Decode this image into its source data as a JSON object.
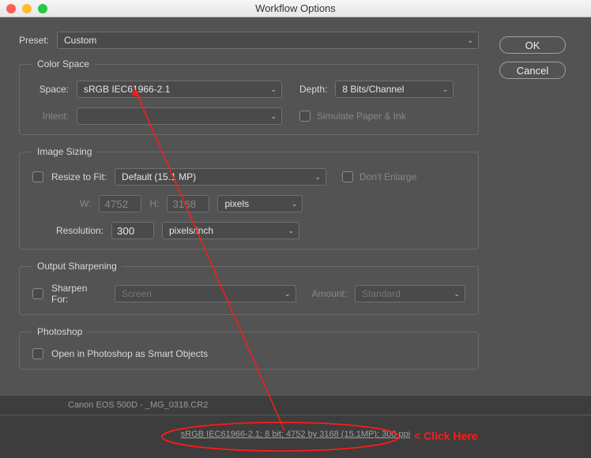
{
  "window_title": "Workflow Options",
  "preset_label": "Preset:",
  "preset_value": "Custom",
  "buttons": {
    "ok": "OK",
    "cancel": "Cancel"
  },
  "colorspace": {
    "legend": "Color Space",
    "space_label": "Space:",
    "space_value": "sRGB IEC61966-2.1",
    "depth_label": "Depth:",
    "depth_value": "8 Bits/Channel",
    "intent_label": "Intent:",
    "intent_value": "",
    "simulate_label": "Simulate Paper & Ink"
  },
  "sizing": {
    "legend": "Image Sizing",
    "resize_label": "Resize to Fit:",
    "resize_value": "Default  (15.1 MP)",
    "dont_enlarge": "Don't Enlarge",
    "w_label": "W:",
    "w_value": "4752",
    "h_label": "H:",
    "h_value": "3168",
    "wh_units": "pixels",
    "resolution_label": "Resolution:",
    "resolution_value": "300",
    "resolution_units": "pixels/inch"
  },
  "sharpen": {
    "legend": "Output Sharpening",
    "sharpen_label": "Sharpen For:",
    "sharpen_value": "Screen",
    "amount_label": "Amount:",
    "amount_value": "Standard"
  },
  "photoshop": {
    "legend": "Photoshop",
    "smart_objects": "Open in Photoshop as Smart Objects"
  },
  "footer": {
    "camera": "Canon EOS 500D  -  _MG_0318.CR2",
    "status": "sRGB IEC61966-2.1; 8 bit; 4752 by 3168 (15.1MP); 300 ppi"
  },
  "annotation": "< Click Here"
}
